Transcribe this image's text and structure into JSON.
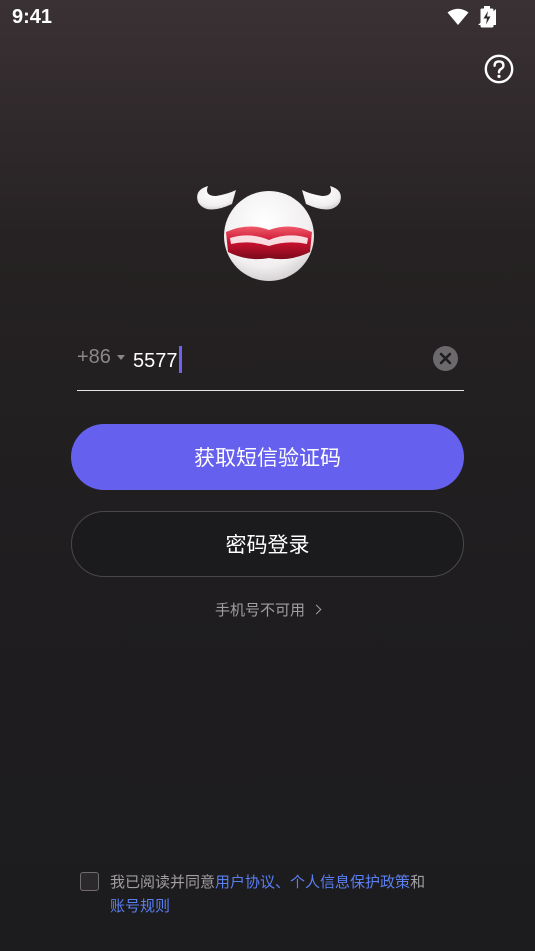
{
  "status_bar": {
    "time": "9:41",
    "icons": [
      "wifi-icon",
      "signal-icon",
      "battery-charging-icon"
    ]
  },
  "header": {
    "help_icon": "question-circle-icon"
  },
  "login": {
    "country_code": "+86",
    "phone_value": "5577",
    "clear_icon": "clear-circle-icon",
    "sms_button_label": "获取短信验证码",
    "password_login_label": "密码登录",
    "phone_unavailable_label": "手机号不可用"
  },
  "agreement": {
    "prefix": "我已阅读并同意",
    "user_agreement": "用户协议",
    "separator": "、",
    "privacy_policy": "个人信息保护政策",
    "conjunction": "和",
    "account_rules": "账号规则"
  },
  "colors": {
    "accent": "#6660ee",
    "link": "#5a7ff0",
    "background": "#1c1b1d"
  }
}
